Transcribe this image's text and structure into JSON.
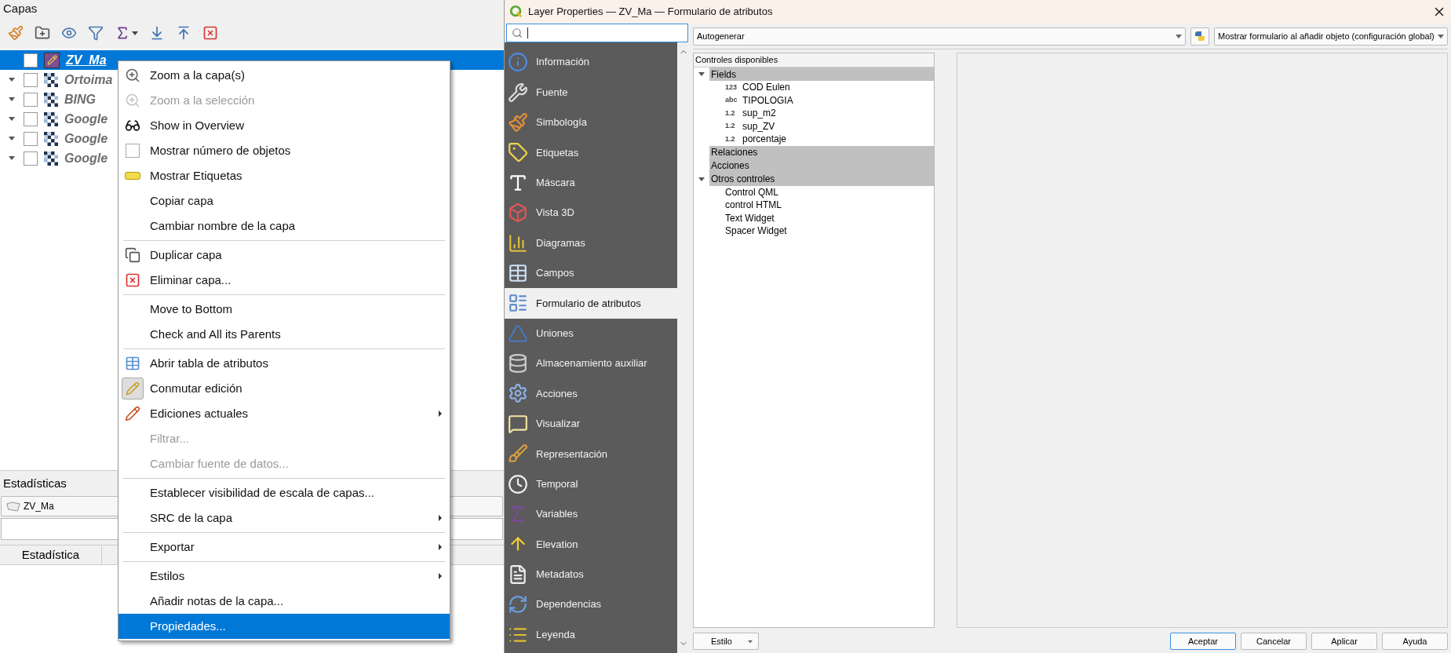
{
  "layers_panel": {
    "title": "Capas",
    "layers": [
      {
        "name": "ZV_Ma",
        "selected": true,
        "checked": false,
        "expander": false,
        "kind": "vector"
      },
      {
        "name": "Ortoima",
        "selected": false,
        "checked": false,
        "expander": true,
        "kind": "raster"
      },
      {
        "name": "BING",
        "selected": false,
        "checked": false,
        "expander": true,
        "kind": "raster"
      },
      {
        "name": "Google",
        "selected": false,
        "checked": false,
        "expander": true,
        "kind": "raster"
      },
      {
        "name": "Google",
        "selected": false,
        "checked": false,
        "expander": true,
        "kind": "raster"
      },
      {
        "name": "Google",
        "selected": false,
        "checked": false,
        "expander": true,
        "kind": "raster"
      }
    ]
  },
  "statistics_panel": {
    "title": "Estadísticas",
    "layer": "ZV_Ma",
    "column": "Estadística"
  },
  "context_menu": {
    "sections": [
      [
        {
          "label": "Zoom a la capa(s)",
          "kind": "action",
          "disabled": false,
          "submenu": false,
          "selected": false
        },
        {
          "label": "Zoom a la selección",
          "kind": "action",
          "disabled": true,
          "submenu": false,
          "selected": false
        },
        {
          "label": "Show in Overview",
          "kind": "action",
          "disabled": false,
          "submenu": false,
          "selected": false
        },
        {
          "label": "Mostrar número de objetos",
          "kind": "checkbox",
          "checked": false,
          "disabled": false,
          "submenu": false,
          "selected": false
        },
        {
          "label": "Mostrar Etiquetas",
          "kind": "action",
          "disabled": false,
          "submenu": false,
          "selected": false
        },
        {
          "label": "Copiar capa",
          "kind": "action",
          "disabled": false,
          "submenu": false,
          "selected": false
        },
        {
          "label": "Cambiar nombre de la capa",
          "kind": "action",
          "disabled": false,
          "submenu": false,
          "selected": false
        }
      ],
      [
        {
          "label": "Duplicar capa",
          "kind": "action",
          "disabled": false,
          "submenu": false,
          "selected": false
        },
        {
          "label": "Eliminar capa...",
          "kind": "action",
          "disabled": false,
          "submenu": false,
          "selected": false
        }
      ],
      [
        {
          "label": "Move to Bottom",
          "kind": "action",
          "disabled": false,
          "submenu": false,
          "selected": false
        },
        {
          "label": "Check and All its Parents",
          "kind": "action",
          "disabled": false,
          "submenu": false,
          "selected": false
        }
      ],
      [
        {
          "label": "Abrir tabla de atributos",
          "kind": "action",
          "disabled": false,
          "submenu": false,
          "selected": false
        },
        {
          "label": "Conmutar edición",
          "kind": "toggle",
          "checked": true,
          "disabled": false,
          "submenu": false,
          "selected": false
        },
        {
          "label": "Ediciones actuales",
          "kind": "action",
          "disabled": false,
          "submenu": true,
          "selected": false
        },
        {
          "label": "Filtrar...",
          "kind": "action",
          "disabled": true,
          "submenu": false,
          "selected": false
        },
        {
          "label": "Cambiar fuente de datos...",
          "kind": "action",
          "disabled": true,
          "submenu": false,
          "selected": false
        }
      ],
      [
        {
          "label": "Establecer visibilidad de escala de capas...",
          "kind": "action",
          "disabled": false,
          "submenu": false,
          "selected": false
        },
        {
          "label": "SRC de la capa",
          "kind": "action",
          "disabled": false,
          "submenu": true,
          "selected": false
        }
      ],
      [
        {
          "label": "Exportar",
          "kind": "action",
          "disabled": false,
          "submenu": true,
          "selected": false
        }
      ],
      [
        {
          "label": "Estilos",
          "kind": "action",
          "disabled": false,
          "submenu": true,
          "selected": false
        },
        {
          "label": "Añadir notas de la capa...",
          "kind": "action",
          "disabled": false,
          "submenu": false,
          "selected": false
        },
        {
          "label": "Propiedades...",
          "kind": "action",
          "disabled": false,
          "submenu": false,
          "selected": true
        }
      ]
    ]
  },
  "dialog": {
    "title": "Layer Properties — ZV_Ma — Formulario de atributos",
    "sidebar": [
      {
        "label": "Información",
        "selected": false
      },
      {
        "label": "Fuente",
        "selected": false
      },
      {
        "label": "Simbología",
        "selected": false
      },
      {
        "label": "Etiquetas",
        "selected": false
      },
      {
        "label": "Máscara",
        "selected": false
      },
      {
        "label": "Vista 3D",
        "selected": false
      },
      {
        "label": "Diagramas",
        "selected": false
      },
      {
        "label": "Campos",
        "selected": false
      },
      {
        "label": "Formulario de atributos",
        "selected": true
      },
      {
        "label": "Uniones",
        "selected": false
      },
      {
        "label": "Almacenamiento auxiliar",
        "selected": false
      },
      {
        "label": "Acciones",
        "selected": false
      },
      {
        "label": "Visualizar",
        "selected": false
      },
      {
        "label": "Representación",
        "selected": false
      },
      {
        "label": "Temporal",
        "selected": false
      },
      {
        "label": "Variables",
        "selected": false
      },
      {
        "label": "Elevation",
        "selected": false
      },
      {
        "label": "Metadatos",
        "selected": false
      },
      {
        "label": "Dependencias",
        "selected": false
      },
      {
        "label": "Leyenda",
        "selected": false
      }
    ],
    "layout_mode": "Autogenerar",
    "form_option": "Mostrar formulario al añadir objeto (configuración global)",
    "tree": {
      "title": "Controles disponibles",
      "groups": [
        {
          "label": "Fields",
          "expanded": true,
          "children": [
            {
              "type_label": "123",
              "label": "COD Eulen"
            },
            {
              "type_label": "abc",
              "label": "TIPOLOGIA"
            },
            {
              "type_label": "1.2",
              "label": "sup_m2"
            },
            {
              "type_label": "1.2",
              "label": "sup_ZV"
            },
            {
              "type_label": "1.2",
              "label": "porcentaje"
            }
          ]
        },
        {
          "label": "Relaciones"
        },
        {
          "label": "Acciones"
        },
        {
          "label": "Otros controles",
          "expanded": true,
          "children": [
            {
              "label": "Control QML"
            },
            {
              "label": "control HTML"
            },
            {
              "label": "Text Widget"
            },
            {
              "label": "Spacer Widget"
            }
          ]
        }
      ]
    },
    "style_button": "Estilo",
    "buttons": [
      {
        "label": "Aceptar",
        "default": true
      },
      {
        "label": "Cancelar",
        "default": false
      },
      {
        "label": "Aplicar",
        "default": false
      },
      {
        "label": "Ayuda",
        "default": false
      }
    ]
  }
}
